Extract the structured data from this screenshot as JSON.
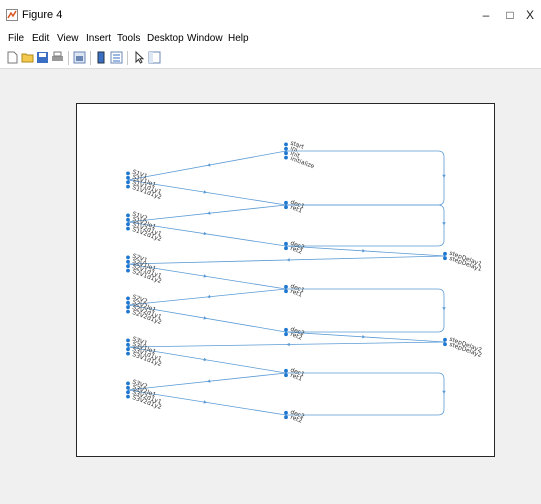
{
  "window": {
    "title": "Figure 4",
    "minimize_glyph": "–",
    "maximize_glyph": "□",
    "close_glyph": "X",
    "icon": "matlab-figure-icon"
  },
  "menu": [
    {
      "label": "File"
    },
    {
      "label": "Edit"
    },
    {
      "label": "View"
    },
    {
      "label": "Insert"
    },
    {
      "label": "Tools"
    },
    {
      "label": "Desktop"
    },
    {
      "label": "Window"
    },
    {
      "label": "Help"
    }
  ],
  "toolbar": [
    "new-figure-icon",
    "open-file-icon",
    "save-icon",
    "print-icon",
    "link-plot-icon",
    "insert-colorbar-icon",
    "insert-legend-icon",
    "edit-plot-icon",
    "property-inspector-icon"
  ],
  "graph": {
    "edge_color": "#5b9bd5",
    "node_color": "#1f77d0",
    "nodes": [
      {
        "id": "top",
        "labels": [
          "start",
          "ini",
          "init",
          "initialize"
        ]
      },
      {
        "id": "L1",
        "labels": [
          "S1V1",
          "S1V1lo1",
          "S1V1d1y1",
          "S1V1d1y2"
        ]
      },
      {
        "id": "C1",
        "labels": [
          "dec1",
          "ret1"
        ]
      },
      {
        "id": "L2",
        "labels": [
          "S1V2",
          "S1V2lo1",
          "S1V2d1y1",
          "S1V2d1y2"
        ]
      },
      {
        "id": "C2",
        "labels": [
          "dec2",
          "ret2"
        ]
      },
      {
        "id": "R1",
        "labels": [
          "stepDelay1",
          "stepDelay1"
        ]
      },
      {
        "id": "L3",
        "labels": [
          "S2V1",
          "S2V1lo1",
          "S2V1d1y1",
          "S2V1d1y2"
        ]
      },
      {
        "id": "C3",
        "labels": [
          "dec1",
          "ret1"
        ]
      },
      {
        "id": "L4",
        "labels": [
          "S2V2",
          "S2V2lo1",
          "S2V2d1y1",
          "S2V2d1y2"
        ]
      },
      {
        "id": "C4",
        "labels": [
          "dec2",
          "ret2"
        ]
      },
      {
        "id": "R2",
        "labels": [
          "stepDelay2",
          "stepDelay2"
        ]
      },
      {
        "id": "L5",
        "labels": [
          "S3V1",
          "S3V1lo1",
          "S3V1d1y1",
          "S3V1d1y2"
        ]
      },
      {
        "id": "C5",
        "labels": [
          "dec1",
          "ret1"
        ]
      },
      {
        "id": "L6",
        "labels": [
          "S3V2",
          "S3V2lo1",
          "S3V2d1y1",
          "S3V2d1y2"
        ]
      },
      {
        "id": "C6",
        "labels": [
          "dec2",
          "ret2"
        ]
      }
    ],
    "edges": [
      [
        "top",
        "L1"
      ],
      [
        "top",
        "C1"
      ],
      [
        "L1",
        "C1"
      ],
      [
        "C1",
        "L2"
      ],
      [
        "L2",
        "C2"
      ],
      [
        "C1",
        "C2"
      ],
      [
        "C2",
        "R1"
      ],
      [
        "R1",
        "L3"
      ],
      [
        "L3",
        "C3"
      ],
      [
        "C3",
        "L4"
      ],
      [
        "L4",
        "C4"
      ],
      [
        "C3",
        "C4"
      ],
      [
        "C4",
        "R2"
      ],
      [
        "R2",
        "L5"
      ],
      [
        "L5",
        "C5"
      ],
      [
        "C5",
        "L6"
      ],
      [
        "L6",
        "C6"
      ],
      [
        "C5",
        "C6"
      ]
    ]
  }
}
